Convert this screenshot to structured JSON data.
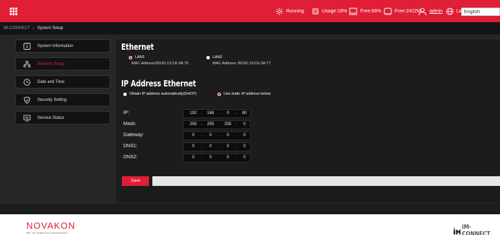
{
  "topbar": {
    "status": {
      "running": "Running",
      "usage": "Usage:18%",
      "free_disk": "Free:66%",
      "free_mem": "Free:2422M",
      "user": "admin",
      "language_label": "Language:",
      "language_value": "English"
    },
    "icons": [
      "grid-icon",
      "gear-icon",
      "cpu-icon",
      "disk-icon",
      "memory-icon",
      "user-icon",
      "globe-icon"
    ],
    "color": "#e01e35"
  },
  "breadcrumb": {
    "root": "IM-CONNECT",
    "separator": "▸",
    "current": "System Setup"
  },
  "sidebar": {
    "items": [
      {
        "label": "System Information",
        "icon": "info-icon",
        "active": false
      },
      {
        "label": "Network Setup",
        "icon": "network-icon",
        "active": true
      },
      {
        "label": "Date and Time",
        "icon": "clock-icon",
        "active": false
      },
      {
        "label": "Security Setting",
        "icon": "shield-icon",
        "active": false
      },
      {
        "label": "Service Status",
        "icon": "monitor-icon",
        "active": false
      }
    ]
  },
  "ethernet": {
    "title": "Ethernet",
    "lan1": {
      "label": "LAN1",
      "mac": "MAC Address:B0:81:13:CE:3A:75",
      "selected": true
    },
    "lan2": {
      "label": "LAN2",
      "mac": "MAC Address: B0:81:13:CE:3A:77",
      "selected": false
    }
  },
  "ip": {
    "title": "IP Address Ethernet",
    "dhcp_label": "Obtain IP address automatically(DHCP)",
    "static_label": "Use static IP address below",
    "mode": "static",
    "rows": [
      {
        "label": "IP:",
        "octets": [
          "192",
          "168",
          "0",
          "80"
        ]
      },
      {
        "label": "Mask:",
        "octets": [
          "255",
          "255",
          "255",
          "0"
        ]
      },
      {
        "label": "Gateway:",
        "octets": [
          "0",
          "0",
          "0",
          "0"
        ]
      },
      {
        "label": "DNS1:",
        "octets": [
          "0",
          "0",
          "0",
          "0"
        ]
      },
      {
        "label": "DNS2:",
        "octets": [
          "0",
          "0",
          "0",
          "0"
        ]
      }
    ]
  },
  "save_label": "Save",
  "footer": {
    "novakon": "NOVAKON",
    "novakon_tagline": "IMR - Your Intelligent IIoT Gateway Solutions",
    "im_connect": "iM-CONNECT"
  }
}
